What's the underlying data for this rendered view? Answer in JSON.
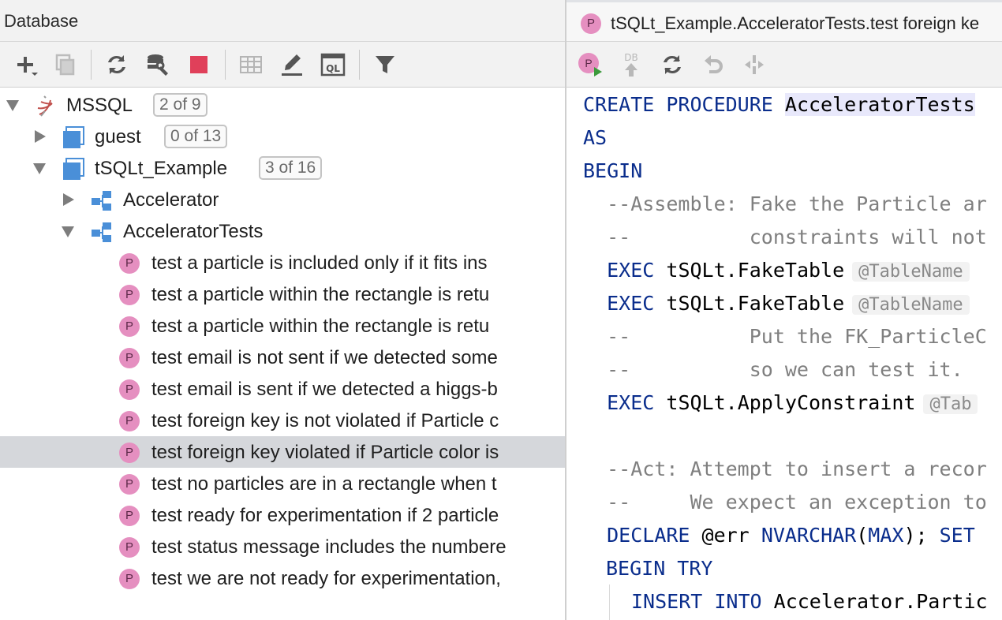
{
  "db_panel": {
    "title": "Database",
    "toolbar": [
      "add-icon",
      "duplicate-icon",
      "refresh-icon",
      "data-source-properties-icon",
      "stop-icon",
      "table-icon",
      "edit-icon",
      "query-console-icon",
      "filter-icon"
    ]
  },
  "tree": {
    "root": {
      "label": "MSSQL",
      "badge": "2 of 9"
    },
    "schemas": [
      {
        "label": "guest",
        "badge": "0 of 13",
        "expanded": false
      },
      {
        "label": "tSQLt_Example",
        "badge": "3 of 16",
        "expanded": true
      }
    ],
    "folders": [
      {
        "label": "Accelerator",
        "expanded": false
      },
      {
        "label": "AcceleratorTests",
        "expanded": true
      }
    ],
    "procedures": [
      "test a particle is included only if it fits ins",
      "test a particle within the rectangle is retu",
      "test a particle within the rectangle is retu",
      "test email is not sent if we detected some",
      "test email is sent if we detected a higgs-b",
      "test foreign key is not violated if Particle c",
      "test foreign key violated if Particle color is",
      "test no particles are in a rectangle when t",
      "test ready for experimentation if 2 particle",
      "test status message includes the numbere",
      "test we are not ready for experimentation,"
    ],
    "selected_index": 6,
    "proc_icon_letter": "P"
  },
  "editor": {
    "tab_title": "tSQLt_Example.AcceleratorTests.test foreign ke",
    "tab_icon_letter": "P",
    "toolbar": [
      "run-procedure-icon",
      "db-submit-icon",
      "refresh-icon",
      "revert-icon",
      "compare-icon"
    ],
    "toolbar_db_label": "DB",
    "code": {
      "l1_kw": "CREATE PROCEDURE",
      "l1_name": "AcceleratorTests",
      "l2": "AS",
      "l3": "BEGIN",
      "l4": "  --Assemble: Fake the Particle ar",
      "l5": "  --          constraints will not",
      "l6_kw": "EXEC",
      "l6_fn": "tSQLt.FakeTable",
      "l6_hint": "@TableName",
      "l7_kw": "EXEC",
      "l7_fn": "tSQLt.FakeTable",
      "l7_hint": "@TableName",
      "l8": "  --          Put the FK_ParticleC",
      "l9": "  --          so we can test it.",
      "l10_kw": "EXEC",
      "l10_fn": "tSQLt.ApplyConstraint",
      "l10_hint": "@Tab",
      "l12": "  --Act: Attempt to insert a recor",
      "l13": "  --     We expect an exception to",
      "l14_kw1": "DECLARE",
      "l14_var": "@err",
      "l14_kw2": "NVARCHAR",
      "l14_p1": "(",
      "l14_kw3": "MAX",
      "l14_p2": ");",
      "l14_kw4": "SET",
      "l15": "BEGIN TRY",
      "l16_kw": "INSERT INTO",
      "l16_rest": "Accelerator.Partic"
    }
  },
  "colors": {
    "keyword": "#0a2d8c",
    "comment": "#7f7f7f",
    "proc_icon": "#e58fc0",
    "selection": "#d5d7db",
    "stop": "#e0405a"
  }
}
